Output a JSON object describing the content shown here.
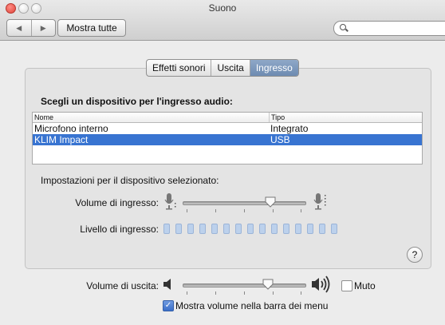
{
  "window": {
    "title": "Suono"
  },
  "toolbar": {
    "back_glyph": "◀",
    "forward_glyph": "▶",
    "show_all_label": "Mostra tutte",
    "search_placeholder": ""
  },
  "tabs": [
    {
      "label": "Effetti sonori",
      "active": false
    },
    {
      "label": "Uscita",
      "active": false
    },
    {
      "label": "Ingresso",
      "active": true
    }
  ],
  "input": {
    "section_title": "Scegli un dispositivo per l'ingresso audio:",
    "columns": {
      "name": "Nome",
      "type": "Tipo"
    },
    "devices": [
      {
        "name": "Microfono interno",
        "type": "Integrato",
        "selected": false
      },
      {
        "name": "KLIM Impact",
        "type": "USB",
        "selected": true
      }
    ],
    "settings_label": "Impostazioni per il dispositivo selezionato:",
    "volume_label": "Volume di ingresso:",
    "volume_level": 0.72,
    "level_label": "Livello di ingresso:",
    "level_segments": 15,
    "help_glyph": "?"
  },
  "output": {
    "volume_label": "Volume di uscita:",
    "volume_level": 0.7,
    "mute_label": "Muto",
    "mute_checked": false,
    "menu_bar_label": "Mostra volume nella barra dei menu",
    "menu_bar_checked": true
  },
  "colors": {
    "selection": "#3874d1",
    "active_tab": "#7f9bbf",
    "level_segment": "#bcd1ec"
  },
  "icons": {
    "mic_low": "microphone-low-icon",
    "mic_high": "microphone-high-icon",
    "speaker_low": "speaker-low-icon",
    "speaker_high": "speaker-high-icon",
    "search": "search-icon",
    "help": "help-icon"
  }
}
